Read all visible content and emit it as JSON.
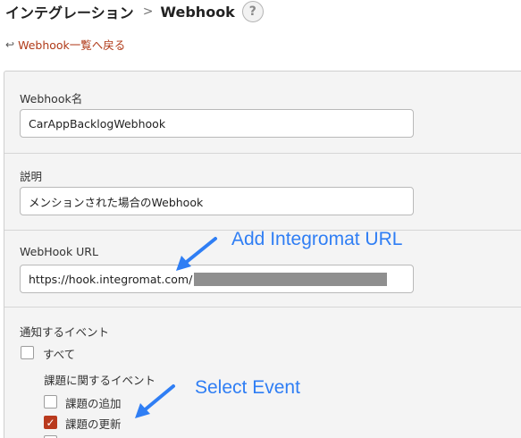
{
  "breadcrumb": {
    "parent": "インテグレーション",
    "separator": ">",
    "current": "Webhook",
    "help": "?"
  },
  "back_link": {
    "icon": "back-arrow-icon",
    "label": "Webhook一覧へ戻る"
  },
  "form": {
    "name_label": "Webhook名",
    "name_value": "CarAppBacklogWebhook",
    "description_label": "説明",
    "description_value": "メンションされた場合のWebhook",
    "url_label": "WebHook URL",
    "url_value": "https://hook.integromat.com/",
    "events_label": "通知するイベント",
    "all_label": "すべて",
    "all_checked": false,
    "issue_events_label": "課題に関するイベント",
    "issue_add_label": "課題の追加",
    "issue_add_checked": false,
    "issue_update_label": "課題の更新",
    "issue_update_checked": true
  },
  "annotations": {
    "url_note": "Add Integromat URL",
    "event_note": "Select Event"
  },
  "colors": {
    "accent": "#b93a1e",
    "link": "#b03a18",
    "annotation": "#2f7ef4"
  }
}
